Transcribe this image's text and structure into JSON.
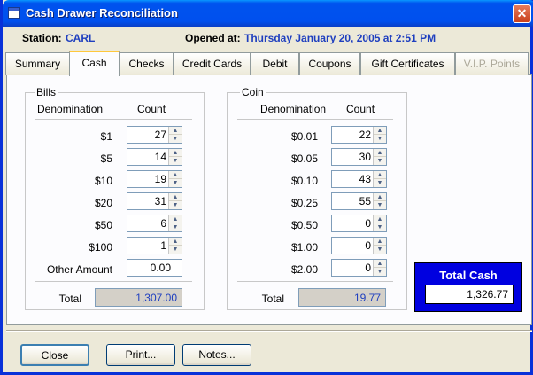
{
  "window": {
    "title": "Cash Drawer Reconciliation",
    "close_glyph": "✕"
  },
  "header": {
    "station_label": "Station:",
    "station_value": "CARL",
    "opened_label": "Opened at:",
    "opened_value": "Thursday January 20, 2005 at 2:51 PM"
  },
  "tabs": [
    {
      "label": "Summary",
      "state": "normal"
    },
    {
      "label": "Cash",
      "state": "active"
    },
    {
      "label": "Checks",
      "state": "normal"
    },
    {
      "label": "Credit Cards",
      "state": "normal"
    },
    {
      "label": "Debit",
      "state": "normal"
    },
    {
      "label": "Coupons",
      "state": "normal"
    },
    {
      "label": "Gift Certificates",
      "state": "normal"
    },
    {
      "label": "V.I.P. Points",
      "state": "disabled"
    }
  ],
  "bills": {
    "title": "Bills",
    "col_denomination": "Denomination",
    "col_count": "Count",
    "rows": [
      {
        "denomination": "$1",
        "count": "27"
      },
      {
        "denomination": "$5",
        "count": "14"
      },
      {
        "denomination": "$10",
        "count": "19"
      },
      {
        "denomination": "$20",
        "count": "31"
      },
      {
        "denomination": "$50",
        "count": "6"
      },
      {
        "denomination": "$100",
        "count": "1"
      }
    ],
    "other_label": "Other Amount",
    "other_value": "0.00",
    "total_label": "Total",
    "total_value": "1,307.00"
  },
  "coin": {
    "title": "Coin",
    "col_denomination": "Denomination",
    "col_count": "Count",
    "rows": [
      {
        "denomination": "$0.01",
        "count": "22"
      },
      {
        "denomination": "$0.05",
        "count": "30"
      },
      {
        "denomination": "$0.10",
        "count": "43"
      },
      {
        "denomination": "$0.25",
        "count": "55"
      },
      {
        "denomination": "$0.50",
        "count": "0"
      },
      {
        "denomination": "$1.00",
        "count": "0"
      },
      {
        "denomination": "$2.00",
        "count": "0"
      }
    ],
    "total_label": "Total",
    "total_value": "19.77"
  },
  "total_cash": {
    "label": "Total Cash",
    "value": "1,326.77"
  },
  "buttons": {
    "close": "Close",
    "print": "Print...",
    "notes": "Notes..."
  },
  "colors": {
    "accent_blue": "#1f3fbf",
    "total_cash_bg": "#0000e0"
  }
}
